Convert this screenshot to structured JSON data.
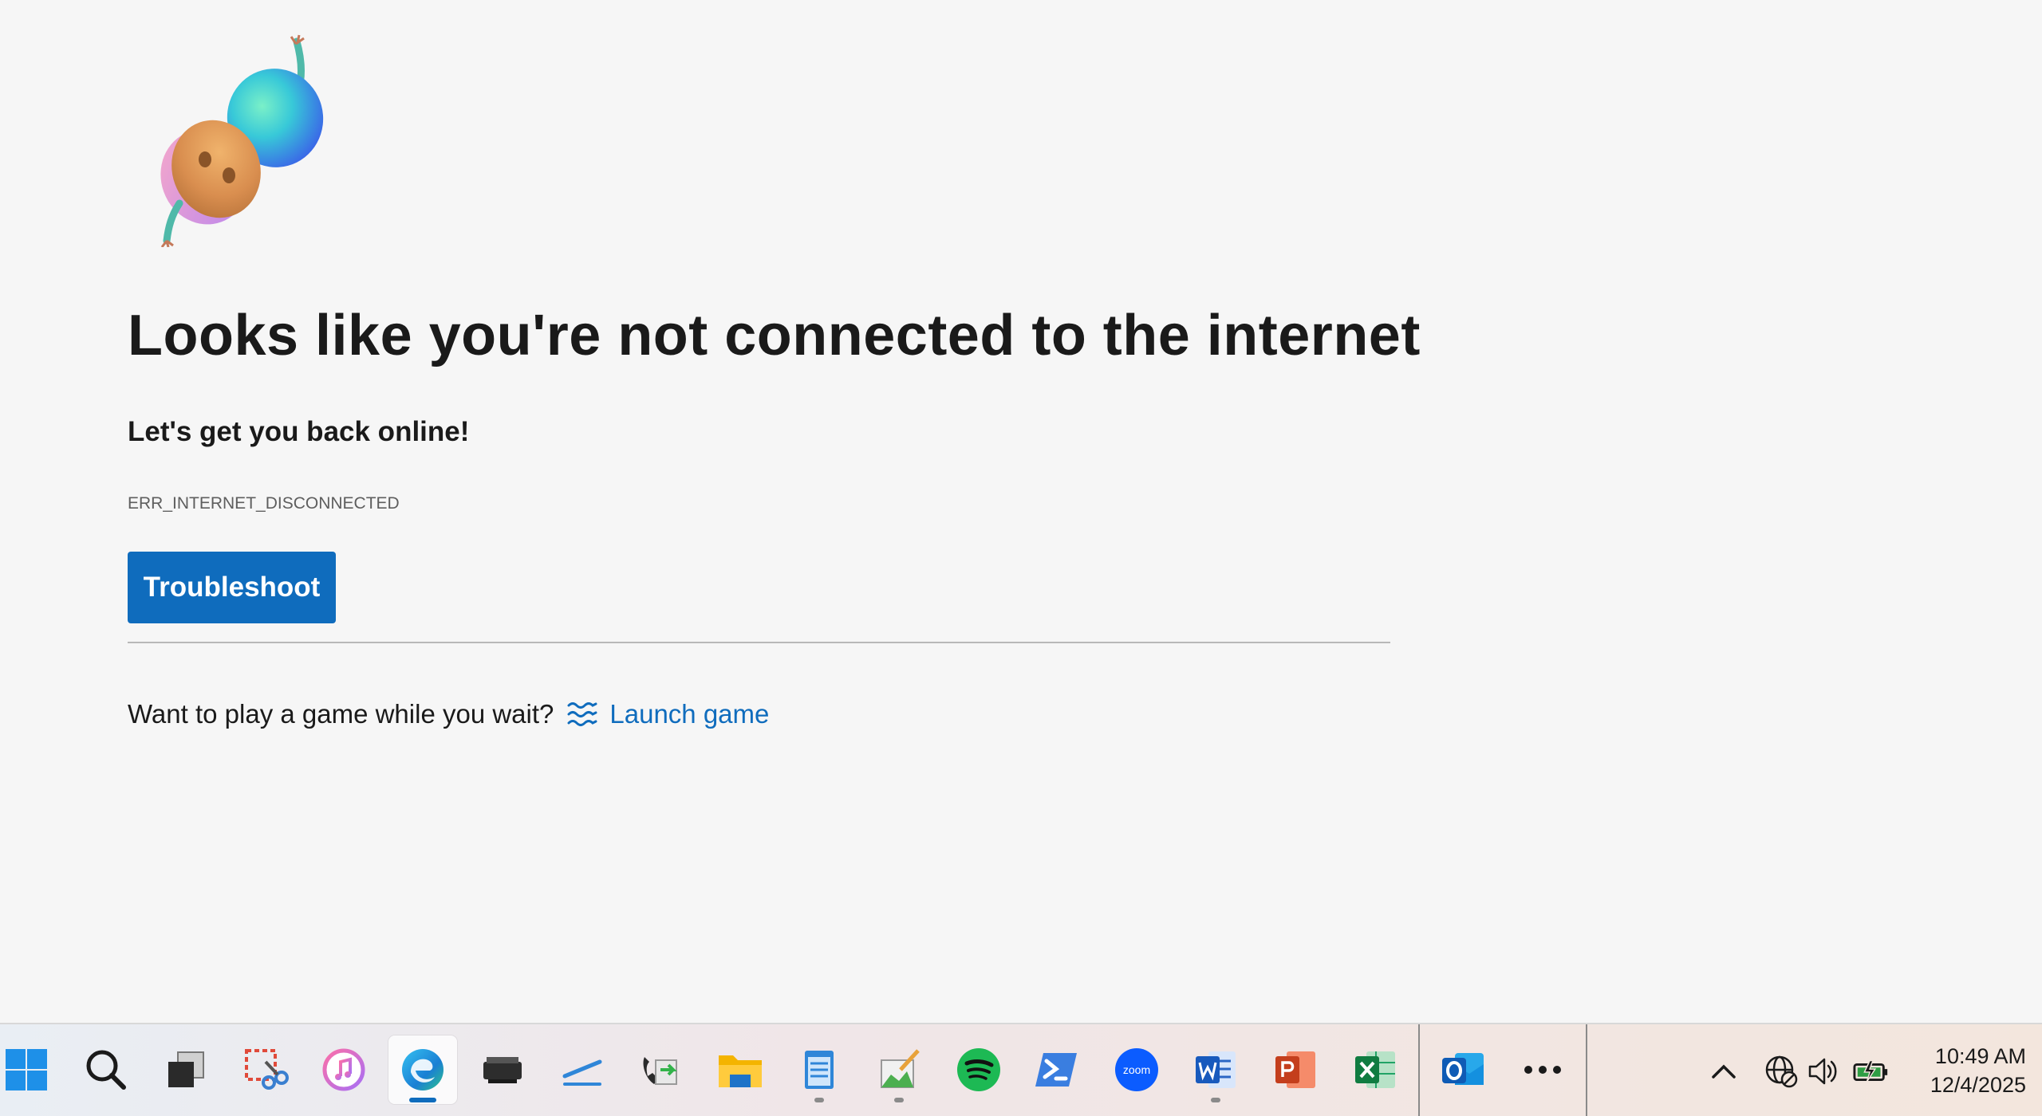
{
  "error_page": {
    "title": "Looks like you're not connected to the internet",
    "subtitle": "Let's get you back online!",
    "error_code": "ERR_INTERNET_DISCONNECTED",
    "troubleshoot_label": "Troubleshoot",
    "game_prompt": "Want to play a game while you wait?",
    "launch_game_label": "Launch game",
    "illustration_icon": "unplugged-plug-illustration",
    "accent_color": "#0f6cbd"
  },
  "taskbar": {
    "apps": [
      {
        "name": "Start",
        "icon": "windows-start-icon"
      },
      {
        "name": "Search",
        "icon": "search-icon"
      },
      {
        "name": "Task View",
        "icon": "task-view-icon"
      },
      {
        "name": "Snipping Tool",
        "icon": "snipping-tool-icon"
      },
      {
        "name": "iTunes",
        "icon": "itunes-icon"
      },
      {
        "name": "Microsoft Edge",
        "icon": "edge-icon",
        "active": true
      },
      {
        "name": "Scanner",
        "icon": "scanner-icon"
      },
      {
        "name": "Pen",
        "icon": "pen-icon"
      },
      {
        "name": "Fax and Scan",
        "icon": "fax-icon"
      },
      {
        "name": "File Explorer",
        "icon": "folder-icon"
      },
      {
        "name": "Notepad",
        "icon": "notepad-icon",
        "running": true
      },
      {
        "name": "Paint",
        "icon": "paint-icon",
        "running": true
      },
      {
        "name": "Spotify",
        "icon": "spotify-icon"
      },
      {
        "name": "PowerShell",
        "icon": "powershell-icon"
      },
      {
        "name": "Zoom",
        "icon": "zoom-icon"
      },
      {
        "name": "Word",
        "icon": "word-icon",
        "running": true
      },
      {
        "name": "PowerPoint",
        "icon": "powerpoint-icon"
      },
      {
        "name": "Excel",
        "icon": "excel-icon"
      },
      {
        "name": "Outlook",
        "icon": "outlook-icon"
      },
      {
        "name": "More",
        "icon": "more-icon"
      }
    ],
    "zoom_label": "zoom",
    "tray": {
      "chevron_icon": "chevron-up-icon",
      "network_icon": "network-disconnected-icon",
      "volume_icon": "volume-icon",
      "battery_icon": "battery-charging-icon"
    },
    "clock": {
      "time": "10:49 AM",
      "date": "12/4/2025"
    }
  }
}
